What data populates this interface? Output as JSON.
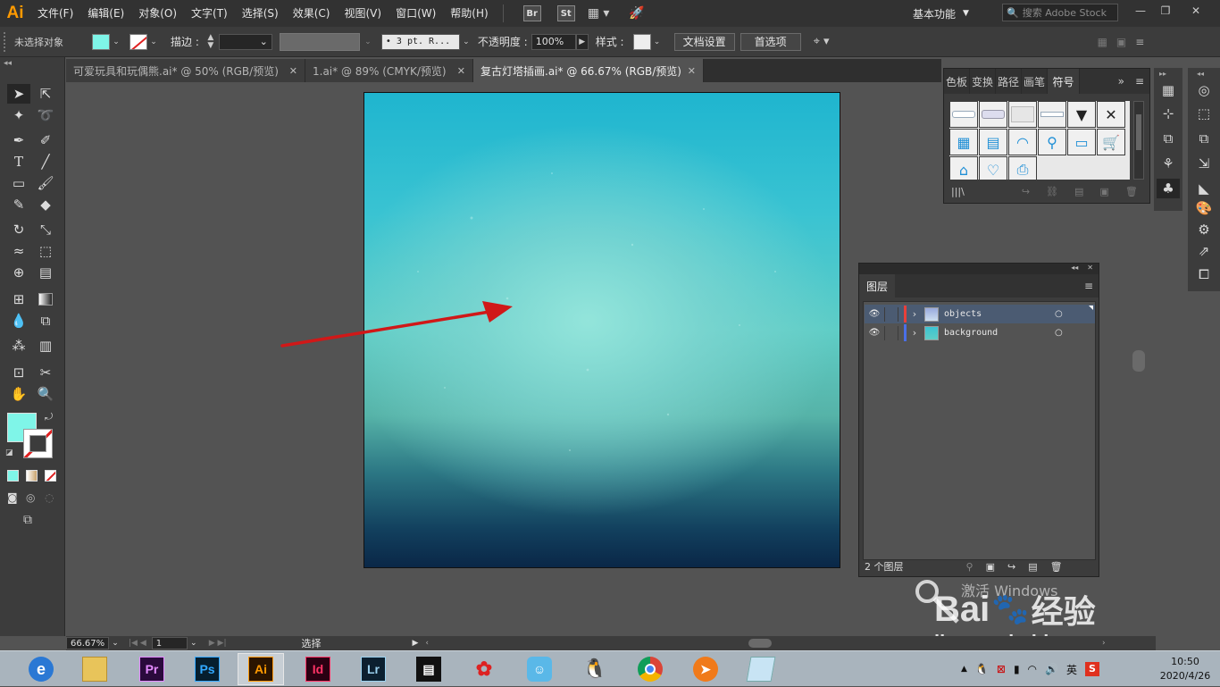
{
  "app": {
    "logo": "Ai"
  },
  "menu": [
    "文件(F)",
    "编辑(E)",
    "对象(O)",
    "文字(T)",
    "选择(S)",
    "效果(C)",
    "视图(V)",
    "窗口(W)",
    "帮助(H)"
  ],
  "bridge_buttons": [
    "Br",
    "St"
  ],
  "workspace": {
    "label": "基本功能",
    "search_placeholder": "搜索 Adobe Stock"
  },
  "control_bar": {
    "no_selection": "未选择对象",
    "fill_color": "#7ff5e8",
    "stroke_label": "描边 :",
    "stroke_profile": "• 3 pt. R...",
    "opacity_label": "不透明度 :",
    "opacity_value": "100%",
    "style_label": "样式 :",
    "doc_setup": "文档设置",
    "preferences": "首选项"
  },
  "tabs": [
    {
      "label": "可爱玩具和玩偶熊.ai* @ 50% (RGB/预览)",
      "active": false
    },
    {
      "label": "1.ai* @ 89% (CMYK/预览)",
      "active": false
    },
    {
      "label": "复古灯塔插画.ai* @ 66.67% (RGB/预览)",
      "active": true
    }
  ],
  "tools": [
    "selection",
    "direct-selection",
    "magic-wand",
    "lasso",
    "pen",
    "curvature",
    "type",
    "line",
    "rectangle",
    "paintbrush",
    "shaper",
    "eraser",
    "rotate",
    "scale",
    "width",
    "free-transform",
    "shape-builder",
    "perspective-grid",
    "mesh",
    "gradient",
    "eyedropper",
    "blend",
    "symbol-sprayer",
    "column-graph",
    "artboard",
    "slice",
    "hand",
    "zoom"
  ],
  "colors": {
    "fill": "#7ff5e8",
    "accent": "#ff9a00",
    "artboard_top": "#1fb5cf",
    "artboard_bottom": "#0a2747",
    "arrow": "#d01818"
  },
  "symbols_panel": {
    "tabs": [
      "色板",
      "变换",
      "路径",
      "画笔",
      "符号"
    ],
    "active_tab": "符号"
  },
  "layers_panel": {
    "title": "图层",
    "layers": [
      {
        "name": "objects",
        "color": "#e8403a",
        "selected": true
      },
      {
        "name": "background",
        "color": "#4a6fe8",
        "selected": false
      }
    ],
    "count": "2 个图层"
  },
  "status": {
    "zoom": "66.67%",
    "artboard": "1",
    "tool": "选择"
  },
  "watermark": {
    "activate": "激活 Windows",
    "brand": "Bai",
    "brand2": "经验",
    "site": "jingyan.baidu.com"
  },
  "taskbar": {
    "apps": [
      "ie",
      "explorer",
      "Pr",
      "Ps",
      "Ai",
      "Id",
      "Lr",
      "media",
      "pinwheel",
      "chat-bot",
      "qq",
      "chrome",
      "player",
      "notepad"
    ],
    "tray_lang": "英",
    "time": "10:50",
    "date": "2020/4/26"
  }
}
